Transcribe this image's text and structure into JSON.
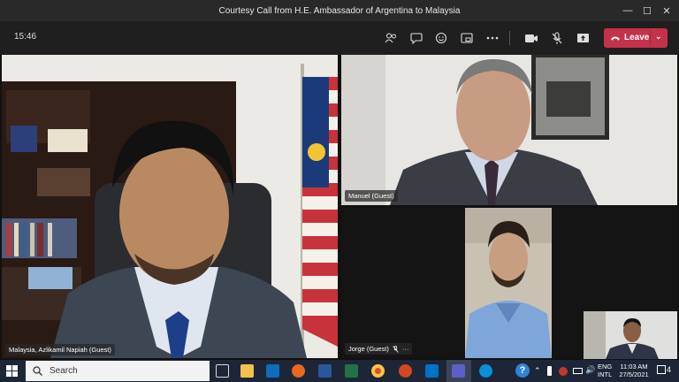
{
  "window": {
    "title": "Courtesy Call from H.E. Ambassador of Argentina to Malaysia"
  },
  "toolbar": {
    "timer": "15:46",
    "leave_label": "Leave",
    "icons": [
      "people-icon",
      "chat-icon",
      "reactions-icon",
      "share-tray-icon",
      "more-options-icon",
      "camera-icon",
      "mic-off-icon",
      "share-icon"
    ]
  },
  "participants": {
    "main": {
      "name": "Malaysia, Azlikamil Napiah (Guest)"
    },
    "top_right": {
      "name": "Manuel (Guest)"
    },
    "bottom": {
      "name": "Jorge (Guest)",
      "more": "···"
    }
  },
  "taskbar": {
    "search_placeholder": "Search",
    "lang_line1": "ENG",
    "lang_line2": "INTL",
    "time": "11:03 AM",
    "date": "27/5/2021",
    "notification_count": "4"
  },
  "colors": {
    "leave": "#c4314b",
    "titlebar": "#292929",
    "toolbar": "#201f1f",
    "taskbar": "#1c2636"
  }
}
